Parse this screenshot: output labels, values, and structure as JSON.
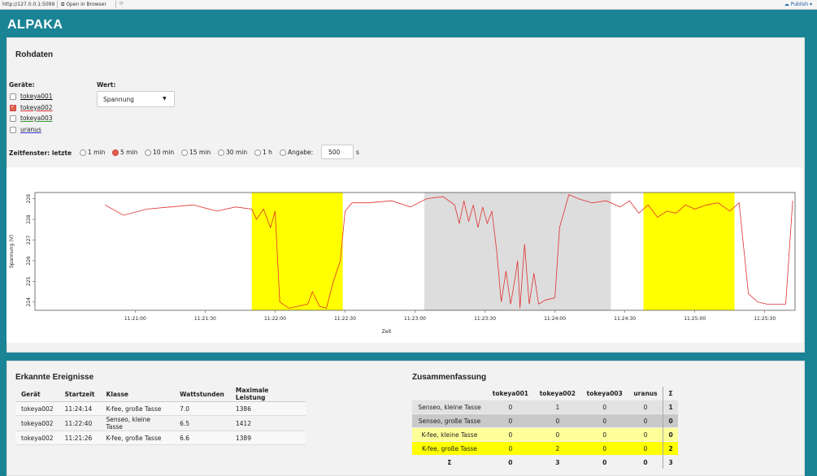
{
  "browser": {
    "url": "http://127.0.0.1:5099",
    "open_in_browser": "Open in Browser",
    "publish": "Publish ▾"
  },
  "app": {
    "title": "ALPAKA"
  },
  "rohdaten": {
    "title": "Rohdaten",
    "geraete_label": "Geräte:",
    "devices": [
      {
        "name": "tokeya001",
        "checked": false,
        "color": "#000000"
      },
      {
        "name": "tokeya002",
        "checked": true,
        "color": "#e03030"
      },
      {
        "name": "tokeya003",
        "checked": false,
        "color": "#30a030"
      },
      {
        "name": "uranus",
        "checked": false,
        "color": "#3030d0"
      }
    ],
    "wert_label": "Wert:",
    "wert_value": "Spannung",
    "zeitfenster_label": "Zeitfenster: letzte",
    "zeit_options": [
      "1 min",
      "5 min",
      "10 min",
      "15 min",
      "30 min",
      "1 h",
      "Angabe:"
    ],
    "zeit_selected": "5 min",
    "angabe_value": "500",
    "angabe_unit": "s"
  },
  "chart_data": {
    "type": "line",
    "xlabel": "Zeit",
    "ylabel": "Spannung (V)",
    "ylim": [
      223.6,
      229.3
    ],
    "y_ticks": [
      "224",
      "225",
      "226",
      "227",
      "228",
      "229"
    ],
    "x_ticks": [
      "11:21:00",
      "11:21:30",
      "11:22:00",
      "11:22:30",
      "11:23:00",
      "11:23:30",
      "11:24:00",
      "11:24:30",
      "11:25:00",
      "11:25:30"
    ],
    "x_range_seconds": [
      -43,
      283
    ],
    "series": [
      {
        "color": "#e03030",
        "points": [
          [
            -13,
            228.7
          ],
          [
            -5,
            228.2
          ],
          [
            5,
            228.5
          ],
          [
            15,
            228.6
          ],
          [
            25,
            228.7
          ],
          [
            35,
            228.4
          ],
          [
            43,
            228.6
          ],
          [
            50,
            228.5
          ],
          [
            52,
            228.0
          ],
          [
            55,
            228.5
          ],
          [
            58,
            227.6
          ],
          [
            60,
            228.4
          ],
          [
            62,
            224.0
          ],
          [
            66,
            223.7
          ],
          [
            70,
            223.8
          ],
          [
            74,
            223.9
          ],
          [
            76,
            224.5
          ],
          [
            79,
            223.8
          ],
          [
            82,
            223.7
          ],
          [
            85,
            225.0
          ],
          [
            88,
            226.0
          ],
          [
            90,
            228.4
          ],
          [
            93,
            228.8
          ],
          [
            100,
            228.8
          ],
          [
            110,
            228.9
          ],
          [
            118,
            228.6
          ],
          [
            125,
            229.0
          ],
          [
            132,
            229.1
          ],
          [
            137,
            228.7
          ],
          [
            139,
            227.8
          ],
          [
            141,
            228.9
          ],
          [
            143,
            227.9
          ],
          [
            145,
            228.7
          ],
          [
            147,
            227.6
          ],
          [
            149,
            228.6
          ],
          [
            151,
            227.8
          ],
          [
            153,
            228.4
          ],
          [
            155,
            226.5
          ],
          [
            157,
            224.0
          ],
          [
            159,
            225.5
          ],
          [
            161,
            223.9
          ],
          [
            163,
            225.2
          ],
          [
            164,
            226.0
          ],
          [
            165,
            223.7
          ],
          [
            167,
            226.8
          ],
          [
            169,
            223.9
          ],
          [
            171,
            225.4
          ],
          [
            173,
            223.9
          ],
          [
            176,
            224.1
          ],
          [
            180,
            224.2
          ],
          [
            182,
            227.6
          ],
          [
            186,
            229.2
          ],
          [
            190,
            229.0
          ],
          [
            196,
            228.8
          ],
          [
            202,
            228.9
          ],
          [
            208,
            228.6
          ],
          [
            212,
            228.9
          ],
          [
            216,
            228.3
          ],
          [
            220,
            228.7
          ],
          [
            224,
            228.1
          ],
          [
            228,
            228.4
          ],
          [
            232,
            228.3
          ],
          [
            236,
            228.7
          ],
          [
            240,
            228.5
          ],
          [
            245,
            228.7
          ],
          [
            250,
            228.8
          ],
          [
            255,
            228.4
          ],
          [
            259,
            228.8
          ],
          [
            263,
            224.4
          ],
          [
            267,
            224.0
          ],
          [
            271,
            223.9
          ],
          [
            275,
            223.9
          ],
          [
            279,
            223.9
          ],
          [
            282,
            228.9
          ]
        ]
      }
    ],
    "highlight_regions": [
      {
        "start": 50,
        "end": 89,
        "color": "#ffff00"
      },
      {
        "start": 124,
        "end": 204,
        "color": "#dddddd"
      },
      {
        "start": 218,
        "end": 257,
        "color": "#ffff00"
      }
    ]
  },
  "ereignisse": {
    "title": "Erkannte Ereignisse",
    "columns": [
      "Gerät",
      "Startzeit",
      "Klasse",
      "Wattstunden",
      "Maximale Leistung"
    ],
    "rows": [
      [
        "tokeya002",
        "11:24:14",
        "K-fee, große Tasse",
        "7.0",
        "1386"
      ],
      [
        "tokeya002",
        "11:22:40",
        "Senseo, kleine Tasse",
        "6.5",
        "1412"
      ],
      [
        "tokeya002",
        "11:21:26",
        "K-fee, große Tasse",
        "6.6",
        "1389"
      ]
    ]
  },
  "zusammenfassung": {
    "title": "Zusammenfassung",
    "columns": [
      "",
      "tokeya001",
      "tokeya002",
      "tokeya003",
      "uranus",
      "Σ"
    ],
    "rows": [
      {
        "cells": [
          "Senseo, kleine Tasse",
          "0",
          "1",
          "0",
          "0",
          "1"
        ],
        "bg": "#e2e2e2"
      },
      {
        "cells": [
          "Senseo, große Tasse",
          "0",
          "0",
          "0",
          "0",
          "0"
        ],
        "bg": "#c9c9c9"
      },
      {
        "cells": [
          "K-fee, kleine Tasse",
          "0",
          "0",
          "0",
          "0",
          "0"
        ],
        "bg": "#ffff99"
      },
      {
        "cells": [
          "K-fee, große Tasse",
          "0",
          "2",
          "0",
          "0",
          "2"
        ],
        "bg": "#ffff00"
      }
    ],
    "total_row": [
      "Σ",
      "0",
      "3",
      "0",
      "0",
      "3"
    ]
  }
}
